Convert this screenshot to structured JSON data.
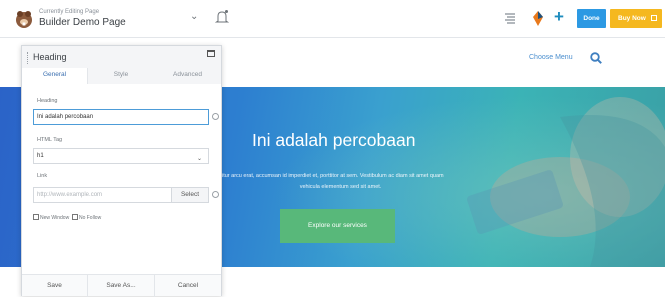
{
  "topbar": {
    "editing_caption": "Currently Editing Page",
    "page_title": "Builder Demo Page",
    "done_label": "Done",
    "buy_label": "Buy Now",
    "colors": {
      "done": "#2c99e3",
      "buy": "#f5b81f",
      "add": "#1e8cbe"
    }
  },
  "site": {
    "menu_label": "Choose Menu"
  },
  "hero": {
    "title": "Ini adalah percobaan",
    "text_line1": "itur arcu erat, accumsan id imperdiet et, porttitor at sem. Vestibulum ac diam sit amet quam",
    "text_line2": "vehicula elementum sed sit amet.",
    "button_label": "Explore our services",
    "colors": {
      "button": "#58b87a",
      "gradient_start": "#2b63c8",
      "gradient_end": "#3a9fa5"
    }
  },
  "panel": {
    "title": "Heading",
    "tabs": [
      {
        "label": "General",
        "active": true
      },
      {
        "label": "Style",
        "active": false
      },
      {
        "label": "Advanced",
        "active": false
      }
    ],
    "heading_label": "Heading",
    "heading_value": "Ini adalah percobaan",
    "tag_label": "HTML Tag",
    "tag_value": "h1",
    "link_label": "Link",
    "link_placeholder": "http://www.example.com",
    "select_label": "Select",
    "new_window_label": "New Window",
    "no_follow_label": "No Follow",
    "footer": {
      "save": "Save",
      "save_as": "Save As...",
      "cancel": "Cancel"
    }
  }
}
